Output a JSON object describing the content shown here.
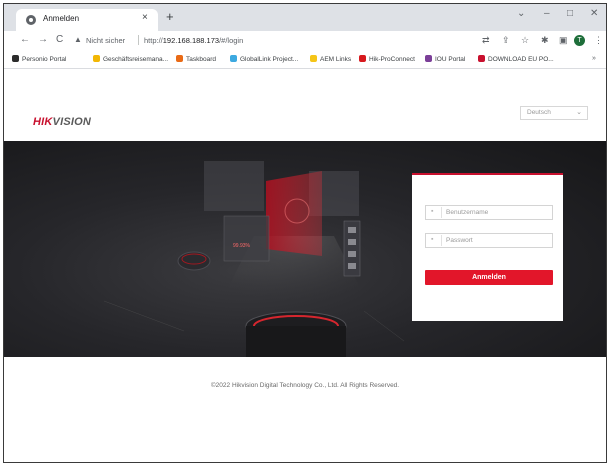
{
  "browser": {
    "tab_title": "Anmelden",
    "tab_close": "×",
    "new_tab": "+",
    "window_buttons": {
      "chevron": "⌄",
      "minimize": "–",
      "maximize": "□",
      "close": "✕"
    },
    "nav": {
      "back": "←",
      "forward": "→",
      "reload": "C"
    },
    "omnibox": {
      "warning_icon": "▲",
      "security_text": "Nicht sicher",
      "url_prefix": "http://",
      "url_host": "192.168.188.173",
      "url_path": "/#/login"
    },
    "profile_initial": "T"
  },
  "bookmarks": [
    {
      "label": "Personio Portal",
      "color": "#2c2c2c"
    },
    {
      "label": "Geschäftsreisemana...",
      "color": "#f2b705"
    },
    {
      "label": "Taskboard",
      "color": "#e96a16"
    },
    {
      "label": "GlobalLink Project...",
      "color": "#3da9e0"
    },
    {
      "label": "AEM Links",
      "color": "#f5c518"
    },
    {
      "label": "Hik-ProConnect",
      "color": "#d7191e"
    },
    {
      "label": "IOU Portal",
      "color": "#7b3f98"
    },
    {
      "label": "DOWNLOAD EU PO...",
      "color": "#c8102e"
    }
  ],
  "bookmarks_more": "»",
  "page": {
    "logo_red": "HIK",
    "logo_gray": "VISION",
    "language": {
      "selected": "Deutsch",
      "chevron": "⌄"
    },
    "login": {
      "username_placeholder": "Benutzername",
      "password_placeholder": "Passwort",
      "submit_label": "Anmelden"
    },
    "hero_readout": "99.93%",
    "footer": "©2022 Hikvision Digital Technology Co., Ltd. All Rights Reserved."
  },
  "colors": {
    "brand_red": "#c8102e",
    "button_red": "#e2162a",
    "hero_dark": "#202023"
  }
}
